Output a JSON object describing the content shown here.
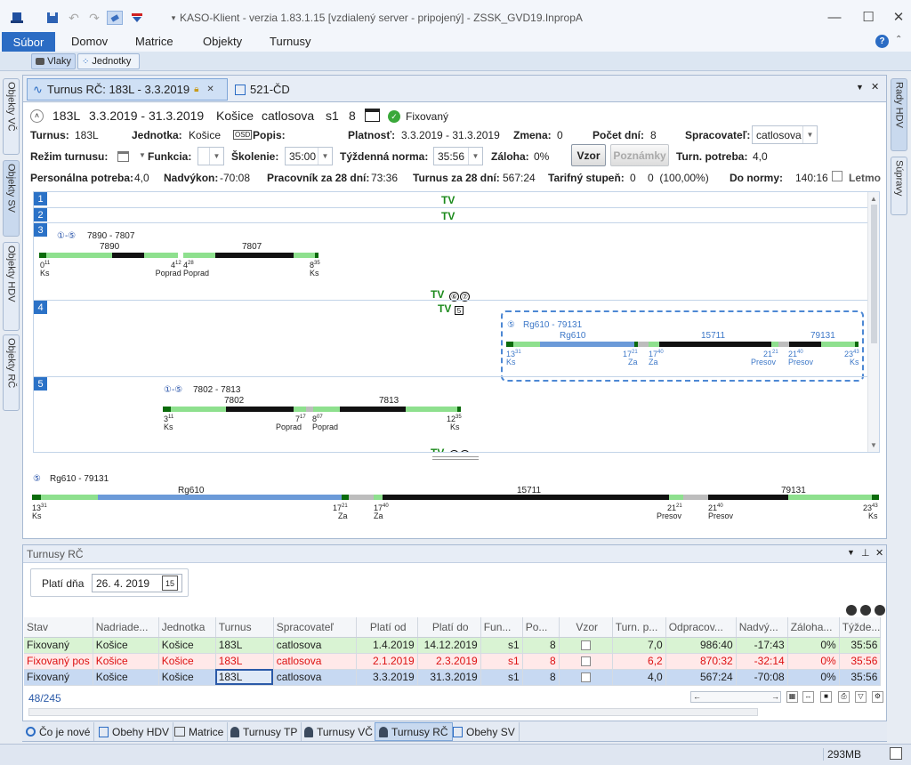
{
  "window": {
    "title": "KASO-Klient - verzia 1.83.1.15 [vzdialený server - pripojený] - ZSSK_GVD19.InpropA"
  },
  "menu": {
    "file": "Súbor",
    "items": [
      "Domov",
      "Matrice",
      "Objekty",
      "Turnusy"
    ]
  },
  "ribbon": {
    "vlaky": "Vlaky",
    "jednotky": "Jednotky"
  },
  "left_tabs": [
    "Objekty VČ",
    "Objekty SV",
    "Objekty HDV",
    "Objekty RČ"
  ],
  "right_tabs": [
    "Rady HDV",
    "Súpravy"
  ],
  "doc_tabs": {
    "active": "Turnus RČ: 183L - 3.3.2019",
    "other": "521-ČD"
  },
  "header": {
    "code": "183L",
    "period": "3.3.2019 - 31.3.2019",
    "station": "Košice",
    "user": "catlosova",
    "shift": "s1",
    "days": "8",
    "status": "Fixovaný",
    "turnus_label": "Turnus:",
    "turnus_value": "183L",
    "jednotka_label": "Jednotka:",
    "jednotka_value": "Košice",
    "osd": "OSD",
    "popis_label": "Popis:",
    "platnost_label": "Platnosť:",
    "platnost_value": "3.3.2019 - 31.3.2019",
    "zmena_label": "Zmena:",
    "zmena_value": "0",
    "pocet_label": "Počet dní:",
    "pocet_value": "8",
    "spracovatel_label": "Spracovateľ:",
    "spracovatel_value": "catlosova",
    "rezim_label": "Režim turnusu:",
    "funkcia_label": "Funkcia:",
    "skolenie_label": "Školenie:",
    "skolenie_value": "35:00",
    "norma_label": "Týždenná norma:",
    "norma_value": "35:56",
    "zaloha_label": "Záloha:",
    "zaloha_value": "0%",
    "vzor": "Vzor",
    "poznamky": "Poznámky",
    "potreba_label": "Turn. potreba:",
    "potreba_value": "4,0",
    "personalna_label": "Personálna potreba:",
    "personalna_value": "4,0",
    "nadvykon_label": "Nadvýkon:",
    "nadvykon_value": "-70:08",
    "pracovnik_label": "Pracovník za 28 dní:",
    "pracovnik_value": "73:36",
    "turnus28_label": "Turnus za 28 dní:",
    "turnus28_value": "567:24",
    "tarif_label": "Tarifný stupeň:",
    "tarif_value": "0    0  (100,00%)",
    "donormy_label": "Do normy:",
    "donormy_value": "140:16",
    "letmo": "Letmo"
  },
  "schedule": {
    "lanes": [
      "1",
      "2",
      "3",
      "4",
      "5"
    ],
    "tv": "TV",
    "days67": [
      "⑥",
      "⑦"
    ],
    "day5": "5",
    "d15": "①-⑤",
    "d5": "⑤",
    "lane3": {
      "head": "7890 - 7807",
      "t1": "7890",
      "t2": "7807",
      "marks": [
        {
          "t": "0",
          "s": "11",
          "st": "Ks"
        },
        {
          "t": "4",
          "s": "12",
          "st": "Poprad"
        },
        {
          "t": "4",
          "s": "28",
          "st": "Poprad"
        },
        {
          "t": "8",
          "s": "35",
          "st": "Ks"
        }
      ]
    },
    "lane4": {
      "head": "Rg610 - 79131",
      "t1": "Rg610",
      "t2": "15711",
      "t3": "79131",
      "marks": [
        {
          "t": "13",
          "s": "31",
          "st": "Ks"
        },
        {
          "t": "17",
          "s": "21",
          "st": "Za"
        },
        {
          "t": "17",
          "s": "40",
          "st": "Za"
        },
        {
          "t": "21",
          "s": "21",
          "st": "Presov"
        },
        {
          "t": "21",
          "s": "40",
          "st": "Presov"
        },
        {
          "t": "23",
          "s": "43",
          "st": "Ks"
        }
      ]
    },
    "lane5": {
      "head": "7802 - 7813",
      "t1": "7802",
      "t2": "7813",
      "marks": [
        {
          "t": "3",
          "s": "11",
          "st": "Ks"
        },
        {
          "t": "7",
          "s": "17",
          "st": "Poprad"
        },
        {
          "t": "8",
          "s": "07",
          "st": "Poprad"
        },
        {
          "t": "12",
          "s": "35",
          "st": "Ks"
        }
      ]
    },
    "detail": {
      "head": "Rg610 - 79131",
      "t1": "Rg610",
      "t2": "15711",
      "t3": "79131",
      "marks": [
        {
          "t": "13",
          "s": "31",
          "st": "Ks"
        },
        {
          "t": "17",
          "s": "21",
          "st": "Za"
        },
        {
          "t": "17",
          "s": "40",
          "st": "Za"
        },
        {
          "t": "21",
          "s": "21",
          "st": "Presov"
        },
        {
          "t": "21",
          "s": "40",
          "st": "Presov"
        },
        {
          "t": "23",
          "s": "43",
          "st": "Ks"
        }
      ]
    }
  },
  "bottom_panel": {
    "title": "Turnusy RČ",
    "plati_label": "Platí dňa",
    "plati_value": "26. 4. 2019",
    "cal": "15",
    "columns": [
      "Stav",
      "Nadriade...",
      "Jednotka",
      "Turnus",
      "Spracovateľ",
      "Platí od",
      "Platí do",
      "Fun...",
      "Po...",
      "Vzor",
      "Turn. p...",
      "Odpracov...",
      "Nadvý...",
      "Záloha...",
      "Týžde..."
    ],
    "rows": [
      [
        "Fixovaný",
        "Košice",
        "Košice",
        "183L",
        "catlosova",
        "1.4.2019",
        "14.12.2019",
        "s1",
        "8",
        "",
        "7,0",
        "986:40",
        "-17:43",
        "0%",
        "35:56"
      ],
      [
        "Fixovaný pos",
        "Košice",
        "Košice",
        "183L",
        "catlosova",
        "2.1.2019",
        "2.3.2019",
        "s1",
        "8",
        "",
        "6,2",
        "870:32",
        "-32:14",
        "0%",
        "35:56"
      ],
      [
        "Fixovaný",
        "Košice",
        "Košice",
        "183L",
        "catlosova",
        "3.3.2019",
        "31.3.2019",
        "s1",
        "8",
        "",
        "4,0",
        "567:24",
        "-70:08",
        "0%",
        "35:56"
      ]
    ],
    "count": "48/245"
  },
  "bottom_tabs": [
    "Čo je nové",
    "Obehy HDV",
    "Matrice",
    "Turnusy TP",
    "Turnusy VČ",
    "Turnusy RČ",
    "Obehy SV"
  ],
  "status": {
    "memory": "293MB"
  },
  "colors": {
    "accent": "#2b6cc4",
    "tv_green": "#1c8a1c",
    "bar_light": "#8ee08e",
    "bar_blue": "#6b9ad8",
    "row_green": "#d9f3d3",
    "row_red": "#ffe9e9",
    "row_sel": "#c7d9f2"
  }
}
